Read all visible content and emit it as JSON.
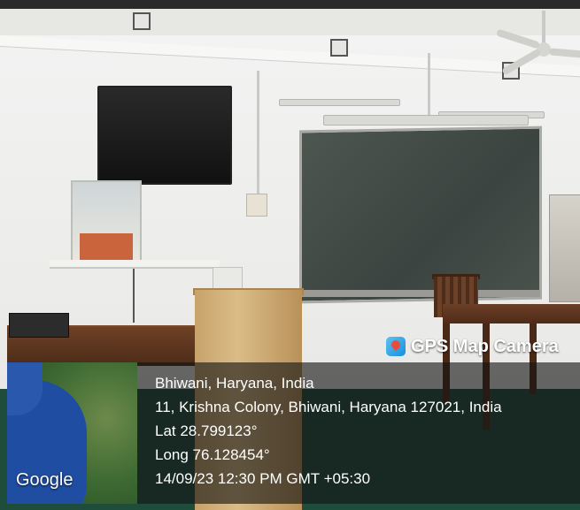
{
  "watermark": {
    "app_name": "GPS Map Camera",
    "city": "Bhiwani, Haryana, India",
    "address": "11, Krishna Colony, Bhiwani, Haryana 127021, India",
    "latitude": "Lat 28.799123°",
    "longitude": "Long 76.128454°",
    "datetime": "14/09/23 12:30 PM GMT +05:30",
    "map_brand": "Google"
  },
  "icons": [
    "gps-map-camera-app-icon"
  ],
  "colors": {
    "panel_bg": "#141414",
    "text": "#ffffff",
    "board": "#434c47",
    "floor": "#1f4d3c"
  }
}
